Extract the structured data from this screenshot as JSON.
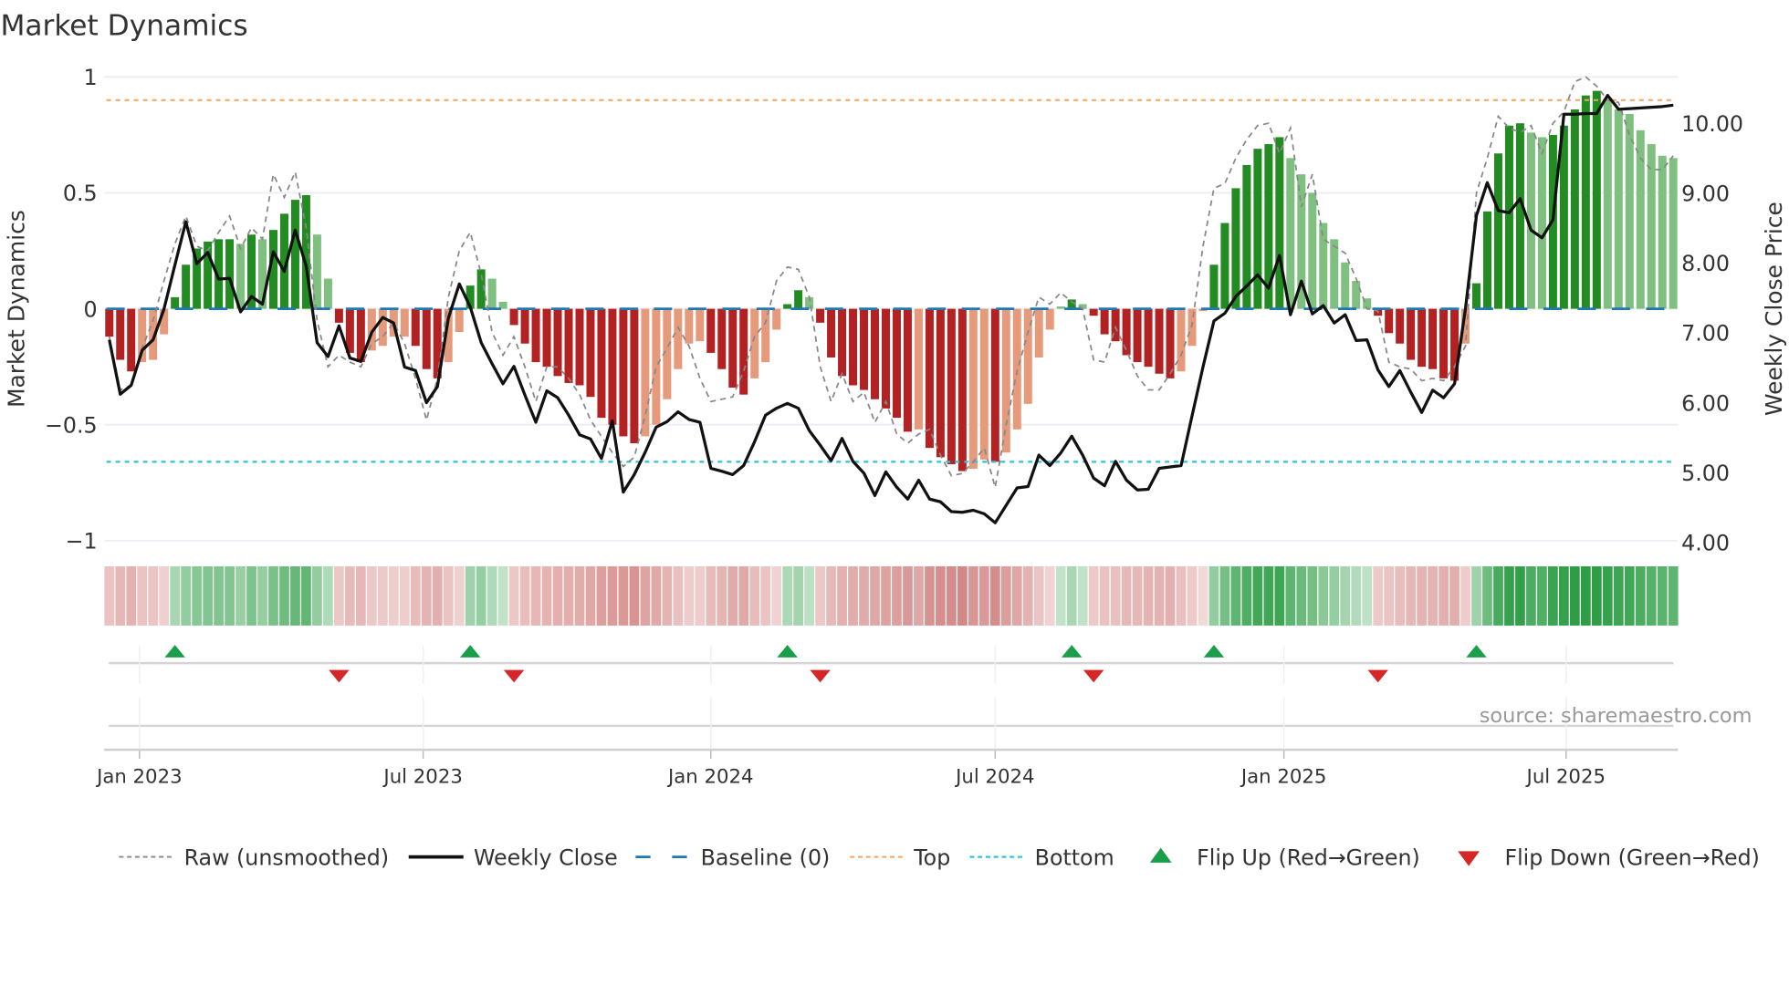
{
  "title": "Market Dynamics",
  "source": "source: sharemaestro.com",
  "colors": {
    "bar_green_strong": "#228b22",
    "bar_green_weak": "#7fbf7f",
    "bar_red_strong": "#b22222",
    "bar_red_weak": "#e59a7c",
    "strip_green": "#2e9e46",
    "strip_red": "#c0504d",
    "baseline": "#1f77b4",
    "top": "#f4a460",
    "bottom": "#2ec4d6",
    "close": "#111111",
    "raw": "#888888",
    "flip_up": "#1a9e4a",
    "flip_down": "#d62728"
  },
  "chart_data": {
    "type": "bar",
    "title": "Market Dynamics",
    "ylabel": "Market Dynamics",
    "y2label": "Weekly Close Price",
    "ylim": [
      -1,
      1
    ],
    "y2lim": [
      4.0,
      10.66
    ],
    "x_unit": "week index (weekly, approx. mid-Dec 2022 to Sep 2025)",
    "x_ticks": [
      {
        "label": "Jan 2023",
        "x": 2.76
      },
      {
        "label": "Jul 2023",
        "x": 28.7
      },
      {
        "label": "Jan 2024",
        "x": 55.0
      },
      {
        "label": "Jul 2024",
        "x": 81.0
      },
      {
        "label": "Jan 2025",
        "x": 107.4
      },
      {
        "label": "Jul 2025",
        "x": 133.2
      }
    ],
    "y_ticks": [
      {
        "label": "1",
        "value": 1
      },
      {
        "label": "0.5",
        "value": 0.5
      },
      {
        "label": "0",
        "value": 0
      },
      {
        "label": "−0.5",
        "value": -0.5
      },
      {
        "label": "−1",
        "value": -1
      }
    ],
    "y2_ticks": [
      {
        "label": "10.00",
        "value": 10
      },
      {
        "label": "9.00",
        "value": 9
      },
      {
        "label": "8.00",
        "value": 8
      },
      {
        "label": "7.00",
        "value": 7
      },
      {
        "label": "6.00",
        "value": 6
      },
      {
        "label": "5.00",
        "value": 5
      },
      {
        "label": "4.00",
        "value": 4
      }
    ],
    "top_level": 0.9,
    "bottom_level": -0.66,
    "baseline": 0,
    "momentum": [
      -0.12,
      -0.22,
      -0.27,
      -0.23,
      -0.22,
      -0.11,
      0.05,
      0.19,
      0.26,
      0.29,
      0.3,
      0.3,
      0.28,
      0.32,
      0.3,
      0.34,
      0.41,
      0.47,
      0.49,
      0.32,
      0.13,
      -0.06,
      -0.19,
      -0.23,
      -0.18,
      -0.16,
      -0.12,
      -0.12,
      -0.16,
      -0.26,
      -0.3,
      -0.23,
      -0.1,
      0.1,
      0.17,
      0.13,
      0.03,
      -0.07,
      -0.15,
      -0.23,
      -0.25,
      -0.29,
      -0.32,
      -0.33,
      -0.38,
      -0.47,
      -0.5,
      -0.55,
      -0.58,
      -0.55,
      -0.5,
      -0.39,
      -0.26,
      -0.15,
      -0.14,
      -0.19,
      -0.26,
      -0.34,
      -0.37,
      -0.3,
      -0.23,
      -0.09,
      0.02,
      0.08,
      0.05,
      -0.06,
      -0.21,
      -0.29,
      -0.33,
      -0.35,
      -0.39,
      -0.43,
      -0.47,
      -0.53,
      -0.52,
      -0.6,
      -0.64,
      -0.67,
      -0.7,
      -0.69,
      -0.65,
      -0.66,
      -0.62,
      -0.52,
      -0.41,
      -0.21,
      -0.09,
      0.01,
      0.04,
      0.02,
      -0.03,
      -0.11,
      -0.14,
      -0.2,
      -0.23,
      -0.25,
      -0.28,
      -0.3,
      -0.27,
      -0.16,
      -0.01,
      0.19,
      0.37,
      0.52,
      0.62,
      0.69,
      0.71,
      0.74,
      0.65,
      0.58,
      0.5,
      0.37,
      0.3,
      0.2,
      0.12,
      0.045,
      -0.03,
      -0.105,
      -0.15,
      -0.22,
      -0.25,
      -0.26,
      -0.3,
      -0.31,
      -0.15,
      0.11,
      0.42,
      0.67,
      0.79,
      0.8,
      0.76,
      0.74,
      0.75,
      0.79,
      0.86,
      0.92,
      0.94,
      0.9,
      0.86,
      0.84,
      0.77,
      0.71,
      0.66,
      0.65
    ],
    "strength_codes": "dddllldddddddldlddddllddd lllldddllddll",
    "raw": [
      -0.12,
      -0.35,
      -0.33,
      -0.17,
      -0.05,
      0.12,
      0.28,
      0.4,
      0.27,
      0.25,
      0.33,
      0.4,
      0.26,
      0.35,
      0.3,
      0.58,
      0.48,
      0.59,
      0.35,
      -0.05,
      -0.25,
      -0.2,
      -0.23,
      -0.25,
      -0.15,
      -0.12,
      -0.06,
      -0.15,
      -0.3,
      -0.48,
      -0.3,
      0.05,
      0.25,
      0.33,
      0.15,
      -0.1,
      -0.2,
      -0.12,
      -0.25,
      -0.4,
      -0.25,
      -0.25,
      -0.3,
      -0.37,
      -0.48,
      -0.55,
      -0.62,
      -0.68,
      -0.64,
      -0.46,
      -0.25,
      -0.17,
      -0.08,
      -0.16,
      -0.3,
      -0.4,
      -0.39,
      -0.38,
      -0.27,
      -0.12,
      -0.06,
      0.12,
      0.18,
      0.17,
      0.05,
      -0.25,
      -0.4,
      -0.28,
      -0.4,
      -0.36,
      -0.49,
      -0.4,
      -0.54,
      -0.58,
      -0.54,
      -0.52,
      -0.63,
      -0.72,
      -0.71,
      -0.66,
      -0.6,
      -0.77,
      -0.5,
      -0.27,
      -0.1,
      0.05,
      0.02,
      0.07,
      0.03,
      0.0,
      -0.22,
      -0.23,
      -0.08,
      -0.18,
      -0.29,
      -0.35,
      -0.35,
      -0.28,
      -0.2,
      -0.07,
      0.27,
      0.52,
      0.54,
      0.65,
      0.73,
      0.79,
      0.8,
      0.67,
      0.78,
      0.44,
      0.58,
      0.3,
      0.27,
      0.24,
      0.13,
      0.0,
      -0.01,
      -0.23,
      -0.25,
      -0.26,
      -0.31,
      -0.3,
      -0.31,
      -0.25,
      -0.16,
      0.5,
      0.65,
      0.83,
      0.78,
      0.76,
      0.79,
      0.67,
      0.8,
      0.85,
      0.98,
      1.0,
      0.96,
      0.9,
      0.89,
      0.75,
      0.65,
      0.6,
      0.6,
      0.66
    ],
    "close": [
      6.9,
      6.12,
      6.25,
      6.75,
      6.9,
      7.34,
      7.97,
      8.59,
      7.99,
      8.15,
      7.77,
      7.78,
      7.3,
      7.52,
      7.41,
      8.16,
      7.88,
      8.47,
      7.96,
      6.86,
      6.66,
      7.1,
      6.64,
      6.59,
      7.01,
      7.22,
      7.14,
      6.51,
      6.46,
      6.0,
      6.23,
      7.21,
      7.7,
      7.37,
      6.86,
      6.56,
      6.27,
      6.52,
      6.11,
      5.72,
      6.17,
      6.07,
      5.82,
      5.54,
      5.48,
      5.2,
      5.74,
      4.72,
      4.97,
      5.29,
      5.65,
      5.73,
      5.87,
      5.76,
      5.72,
      5.06,
      5.02,
      4.97,
      5.1,
      5.44,
      5.82,
      5.92,
      5.99,
      5.92,
      5.6,
      5.39,
      5.17,
      5.49,
      5.16,
      4.99,
      4.67,
      5.01,
      4.79,
      4.62,
      4.89,
      4.62,
      4.58,
      4.44,
      4.43,
      4.46,
      4.41,
      4.28,
      4.53,
      4.78,
      4.8,
      5.25,
      5.1,
      5.28,
      5.52,
      5.25,
      4.92,
      4.81,
      5.16,
      4.89,
      4.75,
      4.76,
      5.06,
      5.08,
      5.1,
      5.81,
      6.51,
      7.17,
      7.28,
      7.52,
      7.67,
      7.83,
      7.64,
      8.11,
      7.26,
      7.74,
      7.27,
      7.39,
      7.14,
      7.26,
      6.89,
      6.9,
      6.47,
      6.23,
      6.46,
      6.15,
      5.86,
      6.18,
      6.07,
      6.27,
      7.35,
      8.68,
      9.15,
      8.75,
      8.72,
      8.92,
      8.47,
      8.36,
      8.62,
      10.13,
      10.13,
      10.14,
      10.14,
      10.4,
      10.2,
      10.21,
      10.22,
      10.23,
      10.24,
      10.26
    ],
    "flip_up": [
      6,
      33,
      62,
      88,
      101,
      125
    ],
    "flip_down": [
      21,
      37,
      65,
      90,
      116
    ],
    "legend": [
      {
        "label": "Raw (unsmoothed)",
        "kind": "raw"
      },
      {
        "label": "Weekly Close",
        "kind": "close"
      },
      {
        "label": "Baseline (0)",
        "kind": "baseline"
      },
      {
        "label": "Top",
        "kind": "top"
      },
      {
        "label": "Bottom",
        "kind": "bottom"
      },
      {
        "label": "Flip Up (Red→Green)",
        "kind": "flip_up"
      },
      {
        "label": "Flip Down (Green→Red)",
        "kind": "flip_down"
      }
    ],
    "legend_position": "bottom"
  }
}
